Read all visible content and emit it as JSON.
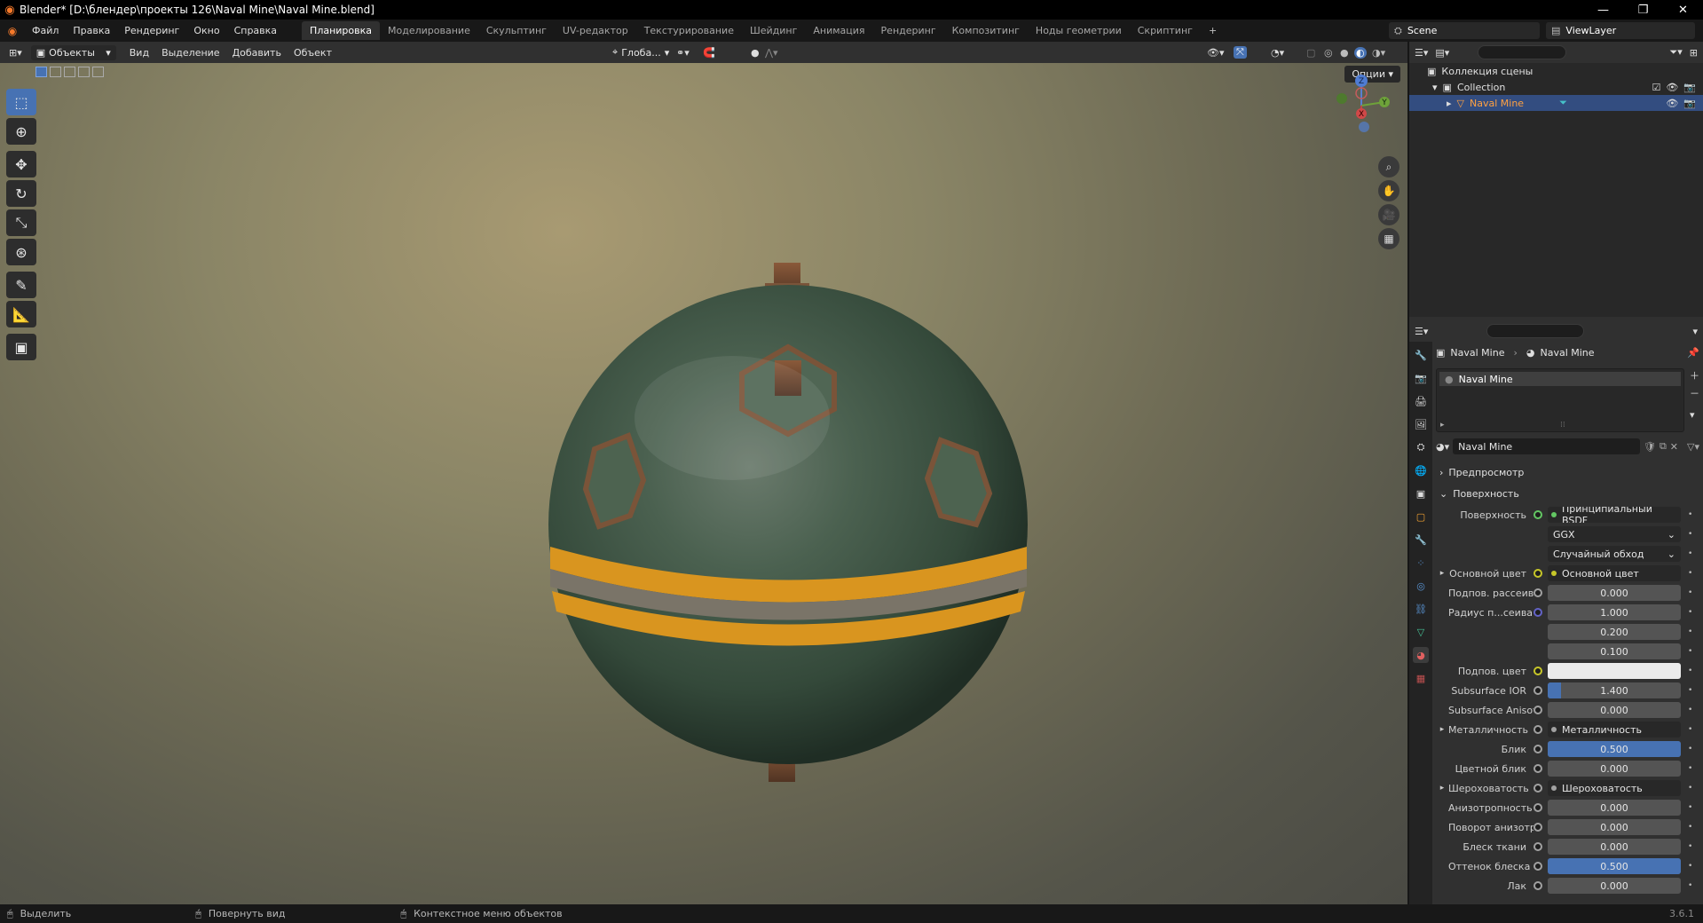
{
  "window": {
    "title": "Blender* [D:\\блендер\\проекты 126\\Naval Mine\\Naval Mine.blend]",
    "controls": [
      "—",
      "❐",
      "✕"
    ]
  },
  "topbar": {
    "menu": [
      "Файл",
      "Правка",
      "Рендеринг",
      "Окно",
      "Справка"
    ],
    "workspaces": [
      "Планировка",
      "Моделирование",
      "Скульптинг",
      "UV-редактор",
      "Текстурирование",
      "Шейдинг",
      "Анимация",
      "Рендеринг",
      "Композитинг",
      "Ноды геометрии",
      "Скриптинг"
    ],
    "active_workspace": "Планировка",
    "add_workspace": "+",
    "scene": "Scene",
    "view_layer": "ViewLayer"
  },
  "viewport_header": {
    "mode": "Объекты",
    "menu": [
      "Вид",
      "Выделение",
      "Добавить",
      "Объект"
    ],
    "orientation": "Глоба...",
    "options": "Опции"
  },
  "gizmo": {
    "z": "Z",
    "y": "Y",
    "x": "X"
  },
  "outliner": {
    "rows": [
      {
        "label": "Коллекция сцены"
      },
      {
        "label": "Collection"
      },
      {
        "label": "Naval Mine"
      }
    ]
  },
  "properties": {
    "breadcrumb": [
      "Naval Mine",
      "Naval Mine"
    ],
    "slot": "Naval Mine",
    "material_name": "Naval Mine",
    "sections": {
      "preview": "Предпросмотр",
      "surface": "Поверхность"
    },
    "rows": [
      {
        "label": "Поверхность",
        "value": "Принципиальный BSDF",
        "kind": "link",
        "socket": "#63c763"
      },
      {
        "label": "",
        "value": "GGX",
        "kind": "dropdown"
      },
      {
        "label": "",
        "value": "Случайный обход",
        "kind": "dropdown"
      },
      {
        "label": "Основной цвет",
        "value": "Основной цвет",
        "kind": "link",
        "socket": "#c7c729",
        "expand": "▸"
      },
      {
        "label": "Подпов. рассеива...",
        "value": "0.000",
        "kind": "num",
        "fill": 0,
        "socket": "#a1a1a1"
      },
      {
        "label": "Радиус п...сеивания",
        "value": "1.000",
        "kind": "num",
        "fill": 0,
        "socket": "#6363c7"
      },
      {
        "label": "",
        "value": "0.200",
        "kind": "num",
        "fill": 0
      },
      {
        "label": "",
        "value": "0.100",
        "kind": "num",
        "fill": 0
      },
      {
        "label": "Подпов. цвет",
        "value": "",
        "kind": "color",
        "socket": "#c7c729"
      },
      {
        "label": "Subsurface IOR",
        "value": "1.400",
        "kind": "num",
        "fill": 0.1,
        "socket": "#a1a1a1"
      },
      {
        "label": "Subsurface Anisotr...",
        "value": "0.000",
        "kind": "num",
        "fill": 0,
        "socket": "#a1a1a1"
      },
      {
        "label": "Металличность",
        "value": "Металличность",
        "kind": "link",
        "socket": "#a1a1a1",
        "expand": "▸"
      },
      {
        "label": "Блик",
        "value": "0.500",
        "kind": "num",
        "fill": 1,
        "socket": "#a1a1a1"
      },
      {
        "label": "Цветной блик",
        "value": "0.000",
        "kind": "num",
        "fill": 0,
        "socket": "#a1a1a1"
      },
      {
        "label": "Шероховатость",
        "value": "Шероховатость",
        "kind": "link",
        "socket": "#a1a1a1",
        "expand": "▸"
      },
      {
        "label": "Анизотропность",
        "value": "0.000",
        "kind": "num",
        "fill": 0,
        "socket": "#a1a1a1"
      },
      {
        "label": "Поворот анизотро...",
        "value": "0.000",
        "kind": "num",
        "fill": 0,
        "socket": "#a1a1a1"
      },
      {
        "label": "Блеск ткани",
        "value": "0.000",
        "kind": "num",
        "fill": 0,
        "socket": "#a1a1a1"
      },
      {
        "label": "Оттенок блеска тк...",
        "value": "0.500",
        "kind": "num",
        "fill": 1,
        "socket": "#a1a1a1"
      },
      {
        "label": "Лак",
        "value": "0.000",
        "kind": "num",
        "fill": 0,
        "socket": "#a1a1a1"
      }
    ]
  },
  "statusbar": {
    "items": [
      "Выделить",
      "Повернуть вид",
      "Контекстное меню объектов"
    ],
    "version": "3.6.1"
  },
  "colors": {
    "accent": "#4772b3",
    "selected_text": "#ffa142",
    "mine_green": "#3f5a44",
    "stripe": "#d9951f"
  }
}
